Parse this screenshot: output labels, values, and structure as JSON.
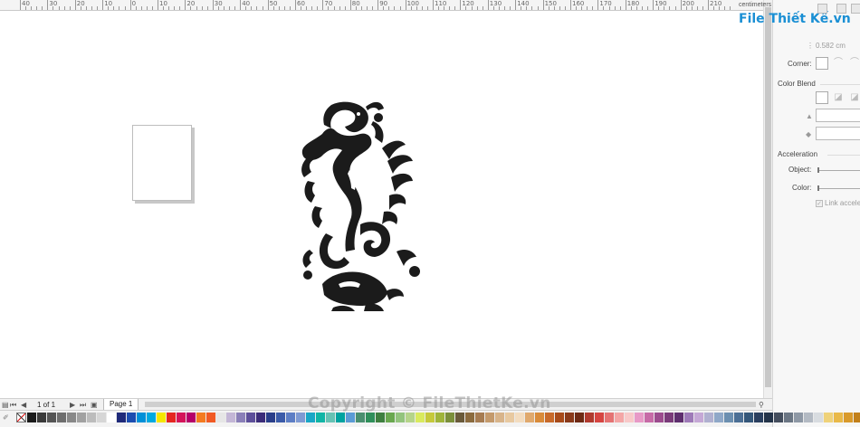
{
  "ruler": {
    "labels": [
      "40",
      "30",
      "20",
      "10",
      "0",
      "10",
      "20",
      "30",
      "40",
      "50",
      "60",
      "70",
      "80",
      "90",
      "100",
      "110",
      "120",
      "130",
      "140",
      "150",
      "160",
      "170",
      "180",
      "190",
      "200",
      "210"
    ],
    "units": "centimeters"
  },
  "brand": {
    "logo": "File Thiết Kế.vn"
  },
  "docker": {
    "width_value": "0.582 cm",
    "corner_label": "Corner:",
    "color_blend_label": "Color Blend",
    "acceleration_label": "Acceleration",
    "object_label": "Object:",
    "color_label": "Color:",
    "link_label": "Link accele"
  },
  "pager": {
    "count": "1 of 1",
    "page_tab": "Page 1"
  },
  "watermark": "Copyright © FileThietKe.vn",
  "palette": {
    "colors": [
      "#1a1a1a",
      "#3a3a3a",
      "#555555",
      "#6e6e6e",
      "#888888",
      "#a1a1a1",
      "#bcbcbc",
      "#d6d6d6",
      "#ffffff",
      "#1f2a7a",
      "#1c4db0",
      "#0090d8",
      "#00a9e0",
      "#f5e600",
      "#e52620",
      "#d4145a",
      "#b5006a",
      "#f47b20",
      "#f15a24",
      "#e6e6e6",
      "#c3b6d6",
      "#8a7fb8",
      "#5d4f9a",
      "#3c2d7a",
      "#2a3e8a",
      "#3b5ba9",
      "#5d7ec5",
      "#7e9ad3",
      "#1aa7c6",
      "#11b5a6",
      "#66c2b4",
      "#00a3a0",
      "#5b9bd5",
      "#4a8f6f",
      "#2f8f5a",
      "#3e7f3f",
      "#6aa84f",
      "#93c47d",
      "#b5d48a",
      "#d9ea5e",
      "#c5c93b",
      "#9fb43a",
      "#7b8f3a",
      "#6a5a3a",
      "#8b6b3e",
      "#a67c52",
      "#c49a6c",
      "#d8b48a",
      "#e8c9a0",
      "#f3dcbf",
      "#e0a96d",
      "#d98b3a",
      "#c86a2a",
      "#a84b1a",
      "#8a3a1a",
      "#6e2a14",
      "#b03a2e",
      "#d64541",
      "#e57373",
      "#f4a6a6",
      "#f8c9c9",
      "#e89ac7",
      "#c76ba7",
      "#9c4c8e",
      "#7a3b7a",
      "#5e2e6e",
      "#9e7ab8",
      "#c5a8d6",
      "#b0b0d0",
      "#8fa8c8",
      "#6c8fb0",
      "#4c6f95",
      "#34577a",
      "#2a3f5f",
      "#24344a",
      "#444e5e",
      "#6b7684",
      "#8e98a5",
      "#b3bac3",
      "#d8dce0",
      "#efd27a",
      "#e9b949",
      "#d99a2b",
      "#c2801a"
    ]
  }
}
